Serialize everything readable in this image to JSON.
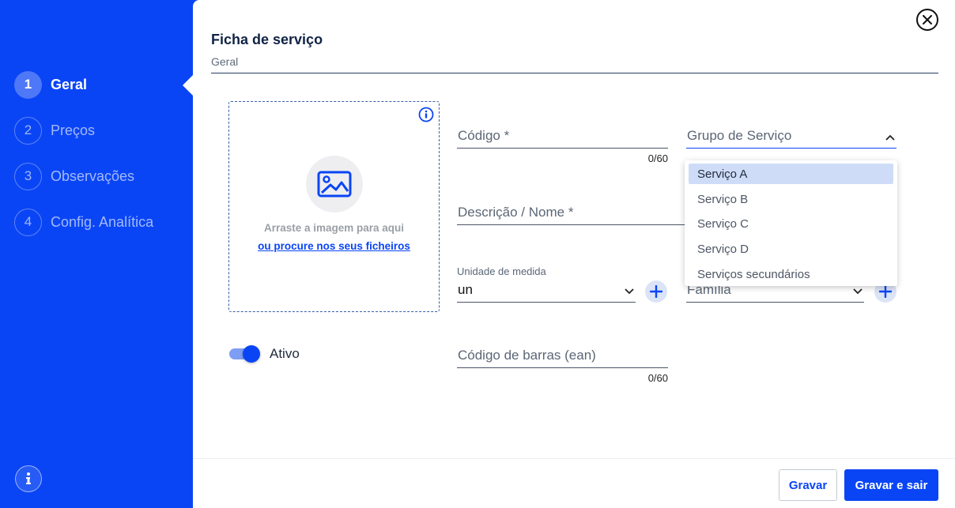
{
  "sidebar": {
    "steps": [
      {
        "num": "1",
        "label": "Geral",
        "active": true
      },
      {
        "num": "2",
        "label": "Preços"
      },
      {
        "num": "3",
        "label": "Observações"
      },
      {
        "num": "4",
        "label": "Config. Analítica"
      }
    ],
    "info_icon": "info-icon"
  },
  "header": {
    "title": "Ficha de serviço",
    "subtitle": "Geral",
    "close_icon": "close-icon"
  },
  "upload": {
    "drag_text": "Arraste a imagem para aqui",
    "browse_text": "ou procure nos seus ficheiros",
    "image_icon": "image-icon",
    "info_icon": "info-icon"
  },
  "form": {
    "codigo": {
      "placeholder": "Código *",
      "counter": "0/60"
    },
    "grupo": {
      "placeholder": "Grupo de Serviço",
      "icon": "chevron-up-icon"
    },
    "descricao": {
      "placeholder": "Descrição / Nome *"
    },
    "unidade": {
      "label": "Unidade de medida",
      "value": "un",
      "icon": "chevron-down-icon"
    },
    "familia": {
      "placeholder": "Família",
      "icon": "chevron-down-icon"
    },
    "barras": {
      "placeholder": "Código de barras (ean)",
      "counter": "0/60"
    },
    "ativo": {
      "label": "Ativo",
      "on": true
    }
  },
  "dropdown": {
    "options": [
      "Serviço A",
      "Serviço B",
      "Serviço C",
      "Serviço D",
      "Serviços secundários"
    ],
    "selected": "Serviço A"
  },
  "footer": {
    "save_label": "Gravar",
    "save_exit_label": "Gravar e sair"
  },
  "colors": {
    "primary": "#0a45f5",
    "sidebar": "#0a45f5",
    "selected_option": "#cfdcf7"
  }
}
